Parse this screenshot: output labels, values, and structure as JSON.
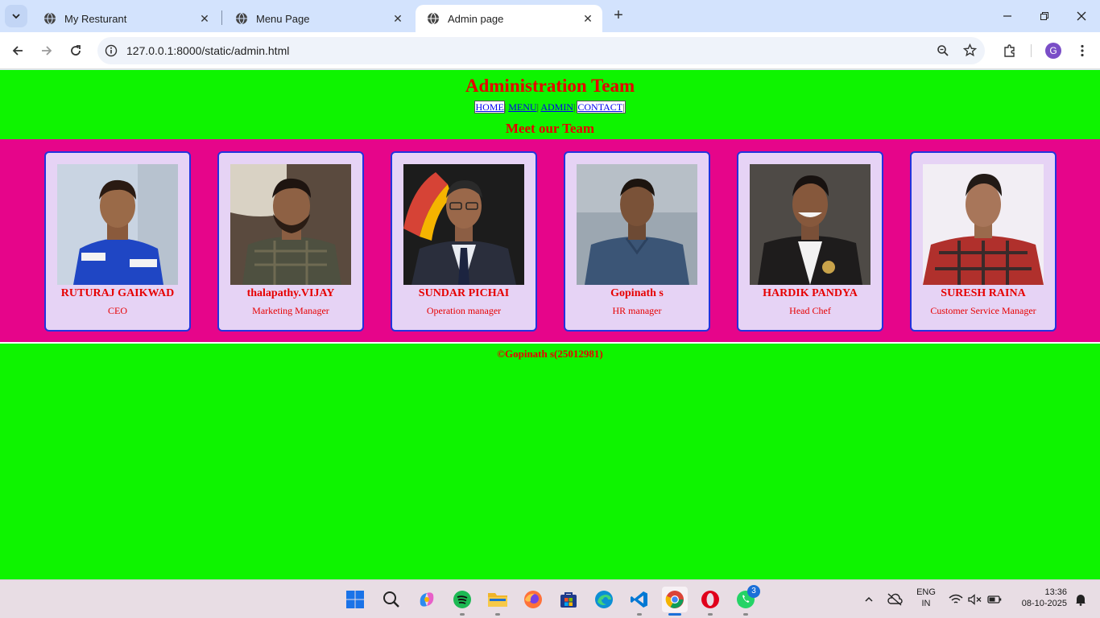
{
  "browser": {
    "tabs": [
      {
        "title": "My Resturant",
        "active": false
      },
      {
        "title": "Menu Page",
        "active": false
      },
      {
        "title": "Admin page",
        "active": true
      }
    ],
    "url": "127.0.0.1:8000/static/admin.html",
    "profile_initial": "G"
  },
  "page": {
    "title": "Administration Team",
    "nav": [
      "HOME",
      "MENU",
      "ADMIN",
      "CONTACT"
    ],
    "nav_separator": "|",
    "subtitle": "Meet our Team",
    "team": [
      {
        "name": "RUTURAJ GAIKWAD",
        "role": "CEO"
      },
      {
        "name": "thalapathy.VIJAY",
        "role": "Marketing Manager"
      },
      {
        "name": "SUNDAR PICHAI",
        "role": "Operation manager"
      },
      {
        "name": "Gopinath s",
        "role": "HR manager"
      },
      {
        "name": "HARDIK PANDYA",
        "role": "Head Chef"
      },
      {
        "name": "SURESH RAINA",
        "role": "Customer Service Manager"
      }
    ],
    "footer": "©Gopinath s(25012981)"
  },
  "taskbar": {
    "whatsapp_badge": "3",
    "language": "ENG",
    "region": "IN",
    "time": "13:36",
    "date": "08-10-2025"
  },
  "colors": {
    "page_background": "#0ef400",
    "heading_red": "#e60000",
    "team_strip": "#e6058a",
    "card_background": "#e6d3f5",
    "card_border": "#2233dd"
  }
}
